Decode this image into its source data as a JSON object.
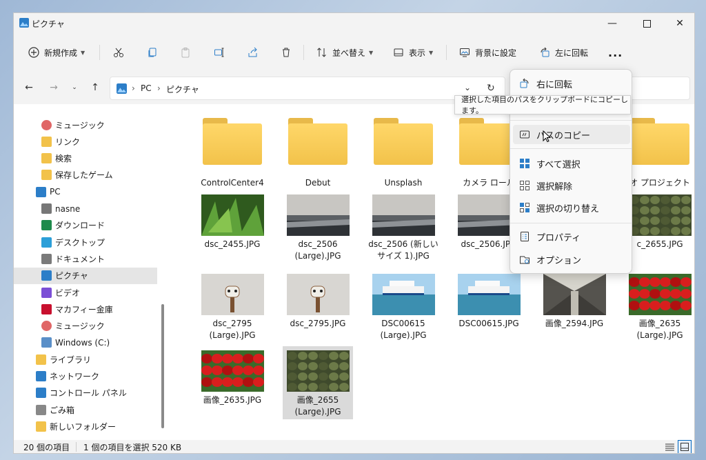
{
  "window": {
    "title": "ピクチャ"
  },
  "toolbar": {
    "new_label": "新規作成",
    "sort_label": "並べ替え",
    "view_label": "表示",
    "set_background_label": "背景に設定",
    "rotate_left_label": "左に回転",
    "more_label": "..."
  },
  "address": {
    "crumbs": [
      "PC",
      "ピクチャ"
    ],
    "separator": "›"
  },
  "sidebar": {
    "items": [
      {
        "label": "ミュージック",
        "icon": "music-icon",
        "color": "#e06666"
      },
      {
        "label": "リンク",
        "icon": "folder-icon",
        "color": "#f2c24a"
      },
      {
        "label": "検索",
        "icon": "folder-icon",
        "color": "#f2c24a"
      },
      {
        "label": "保存したゲーム",
        "icon": "folder-icon",
        "color": "#f2c24a"
      },
      {
        "label": "PC",
        "icon": "pc-icon",
        "color": "#2c7ec8"
      },
      {
        "label": "nasne",
        "icon": "device-icon",
        "color": "#777777"
      },
      {
        "label": "ダウンロード",
        "icon": "download-icon",
        "color": "#1f8a4c"
      },
      {
        "label": "デスクトップ",
        "icon": "desktop-icon",
        "color": "#2c9fd8"
      },
      {
        "label": "ドキュメント",
        "icon": "document-icon",
        "color": "#7a7a7a"
      },
      {
        "label": "ピクチャ",
        "icon": "pictures-icon",
        "color": "#2c7ec8"
      },
      {
        "label": "ビデオ",
        "icon": "video-icon",
        "color": "#7b4fd6"
      },
      {
        "label": "マカフィー金庫",
        "icon": "mcafee-icon",
        "color": "#c8102e"
      },
      {
        "label": "ミュージック",
        "icon": "music-icon",
        "color": "#e06666"
      },
      {
        "label": "Windows (C:)",
        "icon": "drive-icon",
        "color": "#5a8fc8"
      },
      {
        "label": "ライブラリ",
        "icon": "library-icon",
        "color": "#f2c24a"
      },
      {
        "label": "ネットワーク",
        "icon": "network-icon",
        "color": "#2c7ec8"
      },
      {
        "label": "コントロール パネル",
        "icon": "control-panel-icon",
        "color": "#2c7ec8"
      },
      {
        "label": "ごみ箱",
        "icon": "recycle-bin-icon",
        "color": "#888888"
      },
      {
        "label": "新しいフォルダー",
        "icon": "folder-icon",
        "color": "#f2c24a"
      }
    ]
  },
  "files": [
    {
      "name": "ControlCenter4",
      "kind": "folder"
    },
    {
      "name": "Debut",
      "kind": "folder"
    },
    {
      "name": "Unsplash",
      "kind": "folder"
    },
    {
      "name": "カメラ ロール",
      "kind": "folder"
    },
    {
      "name": "オ プロジェクト",
      "kind": "folder"
    },
    {
      "name": "dsc_2455.JPG",
      "kind": "plant"
    },
    {
      "name": "dsc_2506 (Large).JPG",
      "kind": "sea"
    },
    {
      "name": "dsc_2506 (新しいサイズ 1).JPG",
      "kind": "sea"
    },
    {
      "name": "dsc_2506.JPG",
      "kind": "sea"
    },
    {
      "name": "c_2655.JPG",
      "kind": "avocado"
    },
    {
      "name": "dsc_2795 (Large).JPG",
      "kind": "lantern"
    },
    {
      "name": "dsc_2795.JPG",
      "kind": "lantern"
    },
    {
      "name": "DSC00615 (Large).JPG",
      "kind": "ship"
    },
    {
      "name": "DSC00615.JPG",
      "kind": "ship"
    },
    {
      "name": "画像_2594.JPG",
      "kind": "arcade"
    },
    {
      "name": "画像_2635 (Large).JPG",
      "kind": "peppers"
    },
    {
      "name": "画像_2635.JPG",
      "kind": "peppers"
    },
    {
      "name": "画像_2655 (Large).JPG",
      "kind": "avocado"
    }
  ],
  "context_menu": {
    "items": [
      {
        "label": "右に回転",
        "icon": "rotate-right-icon"
      },
      {
        "label": "パスのコピー",
        "icon": "copy-path-icon"
      },
      {
        "label": "すべて選択",
        "icon": "select-all-icon"
      },
      {
        "label": "選択解除",
        "icon": "select-none-icon"
      },
      {
        "label": "選択の切り替え",
        "icon": "invert-selection-icon"
      },
      {
        "label": "プロパティ",
        "icon": "properties-icon"
      },
      {
        "label": "オプション",
        "icon": "options-icon"
      }
    ]
  },
  "tooltip": {
    "text": "選択した項目のパスをクリップボードにコピーします。"
  },
  "status": {
    "item_count": "20 個の項目",
    "selection": "1 個の項目を選択  520 KB"
  },
  "colors": {
    "accent": "#0067c0",
    "folder": "#f2c24a",
    "selected_bg": "#dadada"
  }
}
